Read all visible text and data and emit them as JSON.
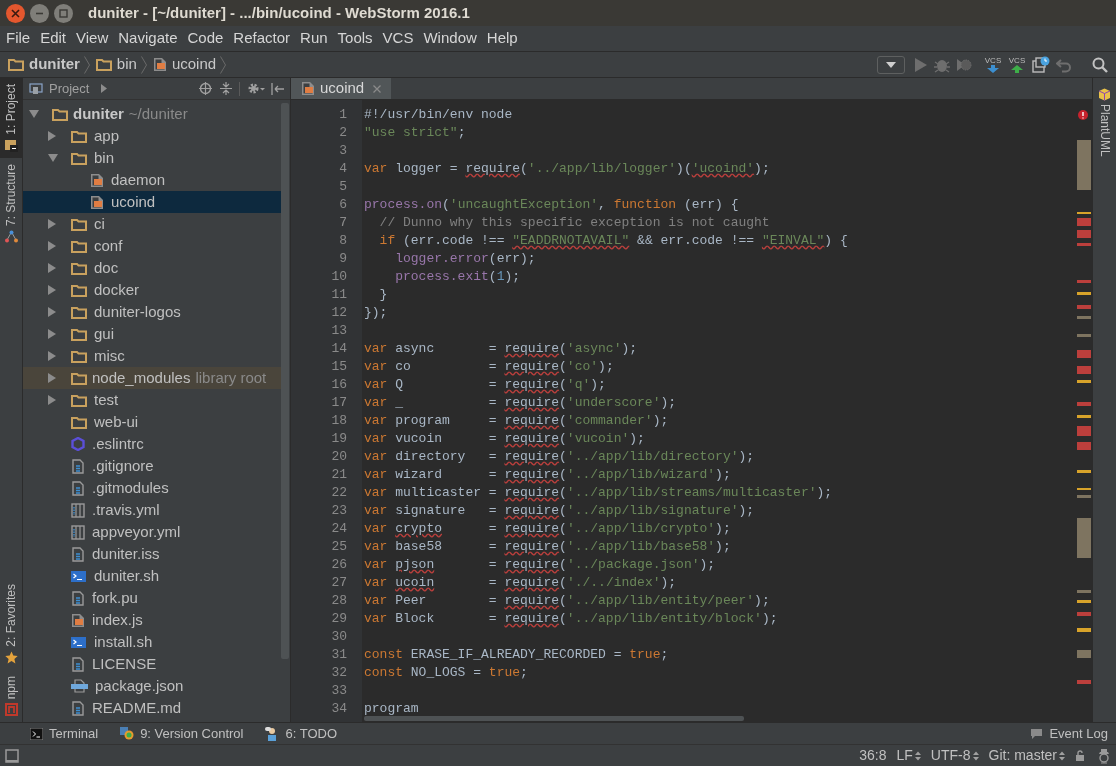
{
  "window": {
    "title": "duniter - [~/duniter] - .../bin/ucoind - WebStorm 2016.1"
  },
  "menu": [
    "File",
    "Edit",
    "View",
    "Navigate",
    "Code",
    "Refactor",
    "Run",
    "Tools",
    "VCS",
    "Window",
    "Help"
  ],
  "breadcrumbs": [
    {
      "label": "duniter",
      "kind": "folder"
    },
    {
      "label": "bin",
      "kind": "folder"
    },
    {
      "label": "ucoind",
      "kind": "js"
    }
  ],
  "toolbar": [
    {
      "kind": "dropdown"
    },
    {
      "kind": "run"
    },
    {
      "kind": "debug"
    },
    {
      "kind": "coverage"
    },
    {
      "kind": "vcs_update",
      "label": "VCS"
    },
    {
      "kind": "vcs_commit",
      "label": "VCS"
    },
    {
      "kind": "history"
    },
    {
      "kind": "revert"
    },
    {
      "kind": "search"
    }
  ],
  "left_tool_tabs": [
    {
      "label": "1: Project",
      "kind": "project",
      "selected": true
    },
    {
      "label": "7: Structure",
      "kind": "structure",
      "selected": false
    }
  ],
  "left_tool_tabs_bottom": [
    {
      "label": "2: Favorites",
      "kind": "favorites",
      "selected": false
    },
    {
      "label": "npm",
      "kind": "npm",
      "selected": false
    }
  ],
  "project_panel": {
    "title": "Project",
    "tree": [
      {
        "name": "duniter",
        "hint": "~/duniter",
        "kind": "folder",
        "expanded": true,
        "selected": false,
        "children": [
          {
            "name": "app",
            "kind": "folder",
            "expanded": false,
            "selected": false
          },
          {
            "name": "bin",
            "kind": "folder",
            "expanded": true,
            "selected": false,
            "children": [
              {
                "name": "daemon",
                "kind": "js",
                "selected": false
              },
              {
                "name": "ucoind",
                "kind": "js",
                "selected": true
              }
            ]
          },
          {
            "name": "ci",
            "kind": "folder",
            "expanded": false,
            "selected": false
          },
          {
            "name": "conf",
            "kind": "folder",
            "expanded": false,
            "selected": false
          },
          {
            "name": "doc",
            "kind": "folder",
            "expanded": false,
            "selected": false
          },
          {
            "name": "docker",
            "kind": "folder",
            "expanded": false,
            "selected": false
          },
          {
            "name": "duniter-logos",
            "kind": "folder",
            "expanded": false,
            "selected": false
          },
          {
            "name": "gui",
            "kind": "folder",
            "expanded": false,
            "selected": false
          },
          {
            "name": "misc",
            "kind": "folder",
            "expanded": false,
            "selected": false
          },
          {
            "name": "node_modules",
            "hint": "library root",
            "kind": "library",
            "expanded": false,
            "selected": false
          },
          {
            "name": "test",
            "kind": "folder",
            "expanded": false,
            "selected": false
          },
          {
            "name": "web-ui",
            "kind": "dir",
            "selected": false
          },
          {
            "name": ".eslintrc",
            "kind": "eslint",
            "selected": false
          },
          {
            "name": ".gitignore",
            "kind": "text",
            "selected": false
          },
          {
            "name": ".gitmodules",
            "kind": "text",
            "selected": false
          },
          {
            "name": ".travis.yml",
            "kind": "yml",
            "selected": false
          },
          {
            "name": "appveyor.yml",
            "kind": "yml",
            "selected": false
          },
          {
            "name": "duniter.iss",
            "kind": "text",
            "selected": false
          },
          {
            "name": "duniter.sh",
            "kind": "shell",
            "selected": false
          },
          {
            "name": "fork.pu",
            "kind": "text",
            "selected": false
          },
          {
            "name": "index.js",
            "kind": "js",
            "selected": false
          },
          {
            "name": "install.sh",
            "kind": "shell",
            "selected": false
          },
          {
            "name": "LICENSE",
            "kind": "text",
            "selected": false
          },
          {
            "name": "package.json",
            "kind": "json",
            "selected": false
          },
          {
            "name": "README.md",
            "kind": "text",
            "selected": false
          }
        ]
      }
    ]
  },
  "editor": {
    "tabs": [
      {
        "label": "ucoind",
        "selected": true
      }
    ],
    "lines": [
      {
        "number": "1",
        "tokens": [
          {
            "kind": "plain",
            "text": "#!/usr/bin/env node"
          }
        ]
      },
      {
        "number": "2",
        "tokens": [
          {
            "kind": "str",
            "text": "\"use strict\""
          },
          {
            "kind": "plain",
            "text": ";"
          }
        ]
      },
      {
        "number": "3"
      },
      {
        "number": "4",
        "tokens": [
          {
            "kind": "kw",
            "text": "var"
          },
          {
            "kind": "plain",
            "text": " logger = "
          },
          {
            "kind": "typo",
            "text": "require"
          },
          {
            "kind": "plain",
            "text": "("
          },
          {
            "kind": "str",
            "text": "'../app/lib/logger'"
          },
          {
            "kind": "plain",
            "text": ")("
          },
          {
            "kind": "str_typo",
            "text": "'ucoind'"
          },
          {
            "kind": "plain",
            "text": ");"
          }
        ]
      },
      {
        "number": "5"
      },
      {
        "number": "6",
        "tokens": [
          {
            "kind": "fn",
            "text": "process.on"
          },
          {
            "kind": "plain",
            "text": "("
          },
          {
            "kind": "str",
            "text": "'uncaughtException'"
          },
          {
            "kind": "plain",
            "text": ", "
          },
          {
            "kind": "kw",
            "text": "function"
          },
          {
            "kind": "plain",
            "text": " (err) {"
          }
        ]
      },
      {
        "number": "7",
        "tokens": [
          {
            "kind": "comment",
            "text": "  // Dunno why this specific exception is not caught"
          }
        ]
      },
      {
        "number": "8",
        "tokens": [
          {
            "kind": "kw",
            "text": "  if"
          },
          {
            "kind": "plain",
            "text": " (err.code !== "
          },
          {
            "kind": "str_typo",
            "text": "\"EADDRNOTAVAIL\""
          },
          {
            "kind": "plain",
            "text": " && err.code !== "
          },
          {
            "kind": "str_typo",
            "text": "\"EINVAL\""
          },
          {
            "kind": "plain",
            "text": ") {"
          }
        ]
      },
      {
        "number": "9",
        "tokens": [
          {
            "kind": "fn",
            "text": "    logger.error"
          },
          {
            "kind": "plain",
            "text": "(err);"
          }
        ]
      },
      {
        "number": "10",
        "tokens": [
          {
            "kind": "fn",
            "text": "    process.exit"
          },
          {
            "kind": "plain",
            "text": "("
          },
          {
            "kind": "num",
            "text": "1"
          },
          {
            "kind": "plain",
            "text": ");"
          }
        ]
      },
      {
        "number": "11",
        "tokens": [
          {
            "kind": "plain",
            "text": "  }"
          }
        ]
      },
      {
        "number": "12",
        "tokens": [
          {
            "kind": "plain",
            "text": "});"
          }
        ]
      },
      {
        "number": "13"
      },
      {
        "number": "14",
        "tokens": [
          {
            "kind": "kw",
            "text": "var"
          },
          {
            "kind": "plain",
            "text": " async       = "
          },
          {
            "kind": "typo",
            "text": "require"
          },
          {
            "kind": "plain",
            "text": "("
          },
          {
            "kind": "str",
            "text": "'async'"
          },
          {
            "kind": "plain",
            "text": ");"
          }
        ]
      },
      {
        "number": "15",
        "tokens": [
          {
            "kind": "kw",
            "text": "var"
          },
          {
            "kind": "plain",
            "text": " co          = "
          },
          {
            "kind": "typo",
            "text": "require"
          },
          {
            "kind": "plain",
            "text": "("
          },
          {
            "kind": "str",
            "text": "'co'"
          },
          {
            "kind": "plain",
            "text": ");"
          }
        ]
      },
      {
        "number": "16",
        "tokens": [
          {
            "kind": "kw",
            "text": "var"
          },
          {
            "kind": "plain",
            "text": " Q           = "
          },
          {
            "kind": "typo",
            "text": "require"
          },
          {
            "kind": "plain",
            "text": "("
          },
          {
            "kind": "str",
            "text": "'q'"
          },
          {
            "kind": "plain",
            "text": ");"
          }
        ]
      },
      {
        "number": "17",
        "tokens": [
          {
            "kind": "kw",
            "text": "var"
          },
          {
            "kind": "plain",
            "text": " _           = "
          },
          {
            "kind": "typo",
            "text": "require"
          },
          {
            "kind": "plain",
            "text": "("
          },
          {
            "kind": "str",
            "text": "'underscore'"
          },
          {
            "kind": "plain",
            "text": ");"
          }
        ]
      },
      {
        "number": "18",
        "tokens": [
          {
            "kind": "kw",
            "text": "var"
          },
          {
            "kind": "plain",
            "text": " program     = "
          },
          {
            "kind": "typo",
            "text": "require"
          },
          {
            "kind": "plain",
            "text": "("
          },
          {
            "kind": "str",
            "text": "'commander'"
          },
          {
            "kind": "plain",
            "text": ");"
          }
        ]
      },
      {
        "number": "19",
        "tokens": [
          {
            "kind": "kw",
            "text": "var"
          },
          {
            "kind": "plain",
            "text": " vucoin      = "
          },
          {
            "kind": "typo",
            "text": "require"
          },
          {
            "kind": "plain",
            "text": "("
          },
          {
            "kind": "str",
            "text": "'vucoin'"
          },
          {
            "kind": "plain",
            "text": ");"
          }
        ]
      },
      {
        "number": "20",
        "tokens": [
          {
            "kind": "kw",
            "text": "var"
          },
          {
            "kind": "plain",
            "text": " directory   = "
          },
          {
            "kind": "typo",
            "text": "require"
          },
          {
            "kind": "plain",
            "text": "("
          },
          {
            "kind": "str",
            "text": "'../app/lib/directory'"
          },
          {
            "kind": "plain",
            "text": ");"
          }
        ]
      },
      {
        "number": "21",
        "tokens": [
          {
            "kind": "kw",
            "text": "var"
          },
          {
            "kind": "plain",
            "text": " wizard      = "
          },
          {
            "kind": "typo",
            "text": "require"
          },
          {
            "kind": "plain",
            "text": "("
          },
          {
            "kind": "str",
            "text": "'../app/lib/wizard'"
          },
          {
            "kind": "plain",
            "text": ");"
          }
        ]
      },
      {
        "number": "22",
        "tokens": [
          {
            "kind": "kw",
            "text": "var"
          },
          {
            "kind": "plain",
            "text": " multicaster = "
          },
          {
            "kind": "typo",
            "text": "require"
          },
          {
            "kind": "plain",
            "text": "("
          },
          {
            "kind": "str",
            "text": "'../app/lib/streams/multicaster'"
          },
          {
            "kind": "plain",
            "text": ");"
          }
        ]
      },
      {
        "number": "23",
        "tokens": [
          {
            "kind": "kw",
            "text": "var"
          },
          {
            "kind": "plain",
            "text": " signature   = "
          },
          {
            "kind": "typo",
            "text": "require"
          },
          {
            "kind": "plain",
            "text": "("
          },
          {
            "kind": "str",
            "text": "'../app/lib/signature'"
          },
          {
            "kind": "plain",
            "text": ");"
          }
        ]
      },
      {
        "number": "24",
        "tokens": [
          {
            "kind": "kw",
            "text": "var "
          },
          {
            "kind": "typo",
            "text": "crypto"
          },
          {
            "kind": "plain",
            "text": "      = "
          },
          {
            "kind": "typo",
            "text": "require"
          },
          {
            "kind": "plain",
            "text": "("
          },
          {
            "kind": "str",
            "text": "'../app/lib/crypto'"
          },
          {
            "kind": "plain",
            "text": ");"
          }
        ]
      },
      {
        "number": "25",
        "tokens": [
          {
            "kind": "kw",
            "text": "var"
          },
          {
            "kind": "plain",
            "text": " base58      = "
          },
          {
            "kind": "typo",
            "text": "require"
          },
          {
            "kind": "plain",
            "text": "("
          },
          {
            "kind": "str",
            "text": "'../app/lib/base58'"
          },
          {
            "kind": "plain",
            "text": ");"
          }
        ]
      },
      {
        "number": "26",
        "tokens": [
          {
            "kind": "kw",
            "text": "var "
          },
          {
            "kind": "typo",
            "text": "pjson"
          },
          {
            "kind": "plain",
            "text": "       = "
          },
          {
            "kind": "typo",
            "text": "require"
          },
          {
            "kind": "plain",
            "text": "("
          },
          {
            "kind": "str",
            "text": "'../package.json'"
          },
          {
            "kind": "plain",
            "text": ");"
          }
        ]
      },
      {
        "number": "27",
        "tokens": [
          {
            "kind": "kw",
            "text": "var "
          },
          {
            "kind": "typo",
            "text": "ucoin"
          },
          {
            "kind": "plain",
            "text": "       = "
          },
          {
            "kind": "typo",
            "text": "require"
          },
          {
            "kind": "plain",
            "text": "("
          },
          {
            "kind": "str",
            "text": "'./../index'"
          },
          {
            "kind": "plain",
            "text": ");"
          }
        ]
      },
      {
        "number": "28",
        "tokens": [
          {
            "kind": "kw",
            "text": "var"
          },
          {
            "kind": "plain",
            "text": " Peer        = "
          },
          {
            "kind": "typo",
            "text": "require"
          },
          {
            "kind": "plain",
            "text": "("
          },
          {
            "kind": "str",
            "text": "'../app/lib/entity/peer'"
          },
          {
            "kind": "plain",
            "text": ");"
          }
        ]
      },
      {
        "number": "29",
        "tokens": [
          {
            "kind": "kw",
            "text": "var"
          },
          {
            "kind": "plain",
            "text": " Block       = "
          },
          {
            "kind": "typo",
            "text": "require"
          },
          {
            "kind": "plain",
            "text": "("
          },
          {
            "kind": "str",
            "text": "'../app/lib/entity/block'"
          },
          {
            "kind": "plain",
            "text": ");"
          }
        ]
      },
      {
        "number": "30"
      },
      {
        "number": "31",
        "tokens": [
          {
            "kind": "kw",
            "text": "const"
          },
          {
            "kind": "plain",
            "text": " ERASE_IF_ALREADY_RECORDED = "
          },
          {
            "kind": "kw",
            "text": "true"
          },
          {
            "kind": "plain",
            "text": ";"
          }
        ]
      },
      {
        "number": "32",
        "tokens": [
          {
            "kind": "kw",
            "text": "const"
          },
          {
            "kind": "plain",
            "text": " NO_LOGS = "
          },
          {
            "kind": "kw",
            "text": "true"
          },
          {
            "kind": "plain",
            "text": ";"
          }
        ]
      },
      {
        "number": "33"
      },
      {
        "number": "34",
        "tokens": [
          {
            "kind": "plain",
            "text": "program"
          }
        ]
      }
    ]
  },
  "right_tool_tabs": [
    {
      "label": "PlantUML",
      "kind": "plantuml"
    }
  ],
  "bottom_tools": [
    {
      "label": "Terminal",
      "kind": "terminal"
    },
    {
      "label": "9: Version Control",
      "kind": "vcs"
    },
    {
      "label": "6: TODO",
      "kind": "todo"
    }
  ],
  "event_log": "Event Log",
  "status_bar": [
    {
      "text": "36:8",
      "kind": "text"
    },
    {
      "text": "LF",
      "kind": "menu"
    },
    {
      "text": "UTF-8",
      "kind": "menu"
    },
    {
      "text": "Git: master",
      "kind": "menu"
    }
  ]
}
